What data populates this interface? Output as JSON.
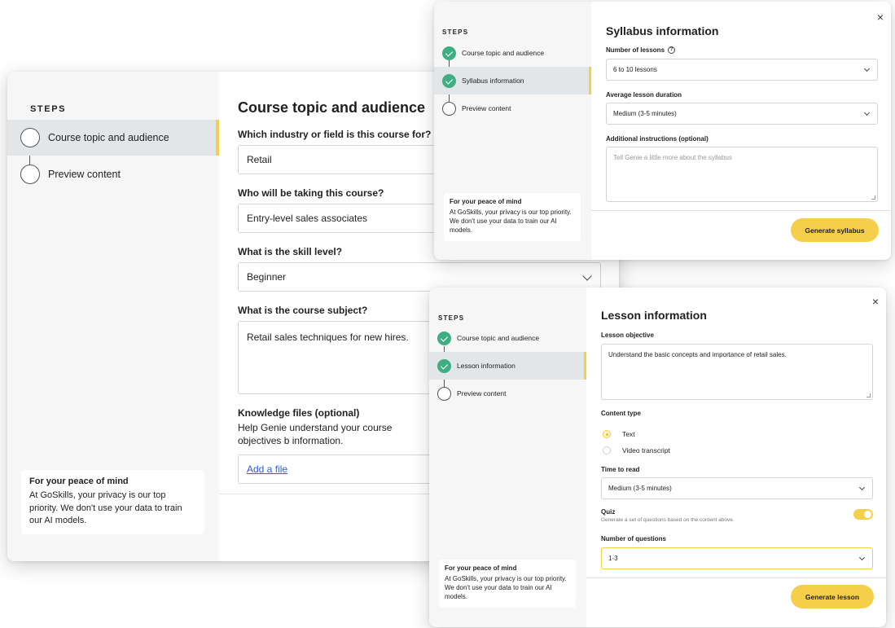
{
  "course_topic_window": {
    "steps_label": "STEPS",
    "steps": [
      "Course topic and audience",
      "Preview content"
    ],
    "privacy": {
      "title": "For your peace of mind",
      "body": "At GoSkills, your privacy is our top priority. We don't use your data to train our AI models."
    },
    "title": "Course topic and audience",
    "industry_label": "Which industry or field is this course for?",
    "industry_value": "Retail",
    "audience_label": "Who will be taking this course?",
    "audience_value": "Entry-level sales associates",
    "skill_label": "What is the skill level?",
    "skill_value": "Beginner",
    "subject_label": "What is the course subject?",
    "subject_value": "Retail sales techniques for new hires.",
    "knowledge_label": "Knowledge files (optional)",
    "knowledge_desc": "Help Genie understand your course objectives b information.",
    "add_file_label": "Add a file"
  },
  "syllabus_window": {
    "steps_label": "STEPS",
    "steps": [
      "Course topic and audience",
      "Syllabus information",
      "Preview content"
    ],
    "privacy": {
      "title": "For your peace of mind",
      "body": "At GoSkills, your privacy is our top priority. We don't use your data to train our AI models."
    },
    "close_icon": "×",
    "title": "Syllabus information",
    "lessons_label": "Number of lessons",
    "info_icon": "?",
    "lessons_value": "6 to 10 lessons",
    "duration_label": "Average lesson duration",
    "duration_value": "Medium (3-5 minutes)",
    "instructions_label": "Additional instructions (optional)",
    "instructions_placeholder": "Tell Genie a little more about the syllabus",
    "generate_label": "Generate syllabus"
  },
  "lesson_window": {
    "steps_label": "STEPS",
    "steps": [
      "Course topic and audience",
      "Lesson information",
      "Preview content"
    ],
    "privacy": {
      "title": "For your peace of mind",
      "body": "At GoSkills, your privacy is our top priority. We don't use your data to train our AI models."
    },
    "close_icon": "×",
    "title": "Lesson information",
    "objective_label": "Lesson objective",
    "objective_value": "Understand the basic concepts and importance of retail sales.",
    "content_type_label": "Content type",
    "content_types": [
      "Text",
      "Video transcript"
    ],
    "selected_content_type": "Text",
    "time_label": "Time to read",
    "time_value": "Medium (3-5 minutes)",
    "quiz_label": "Quiz",
    "quiz_desc": "Generate a set of questions based on the content above.",
    "quiz_enabled": true,
    "questions_label": "Number of questions",
    "questions_value": "1-3",
    "generate_label": "Generate lesson"
  },
  "colors": {
    "accent": "#f5cf4a",
    "step_done": "#3fae84",
    "link": "#2b5fd9",
    "sidebar_bg": "#f6f6f6"
  }
}
